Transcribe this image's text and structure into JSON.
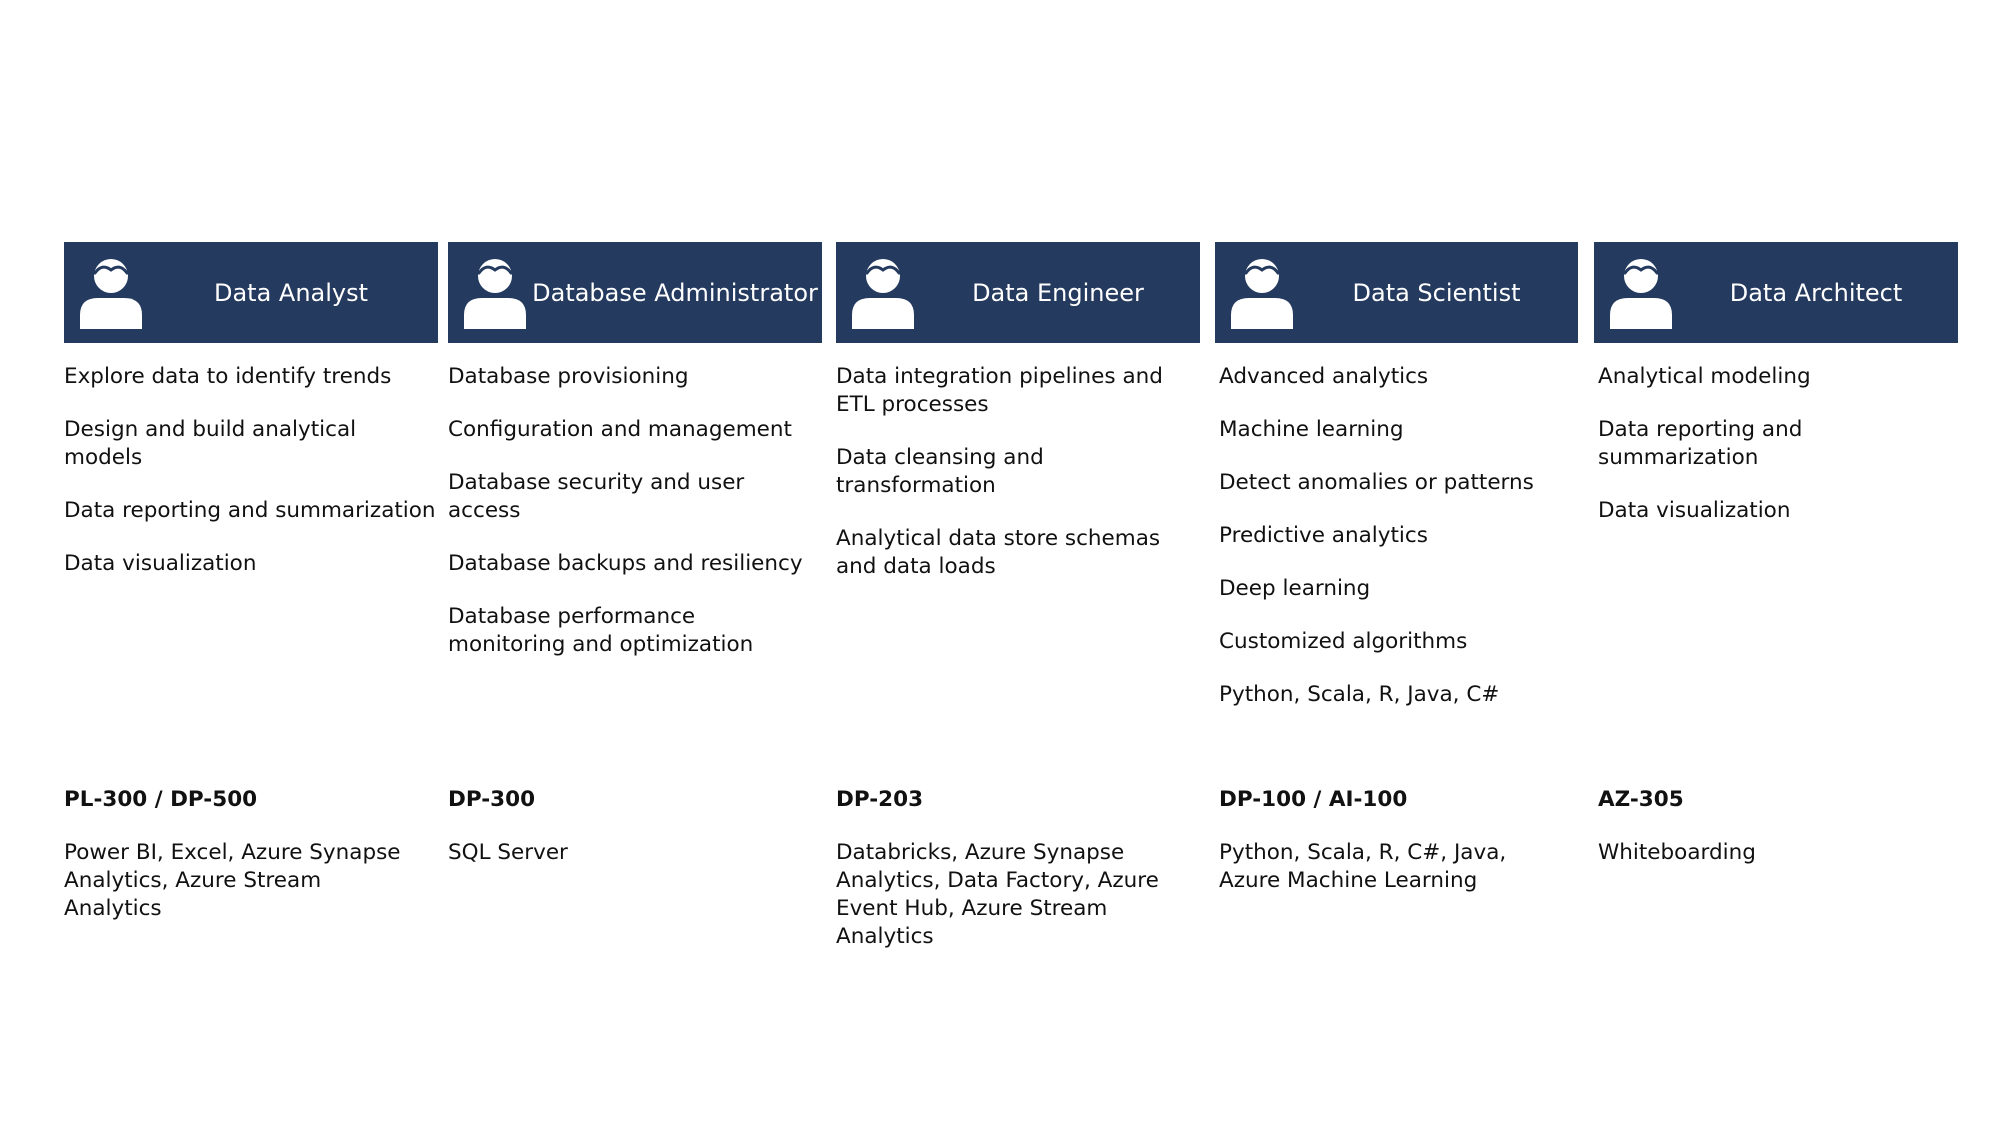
{
  "colors": {
    "header_bg": "#243a5e",
    "header_text": "#ffffff",
    "body_text": "#111111"
  },
  "roles": [
    {
      "title": "Data Analyst",
      "icon": "person-icon",
      "tasks": [
        "Explore data to identify trends",
        "Design and build analytical models",
        "Data reporting and summarization",
        "Data visualization"
      ],
      "certification": "PL-300 / DP-500",
      "tools": "Power BI, Excel, Azure Synapse Analytics, Azure Stream Analytics"
    },
    {
      "title": "Database Administrator",
      "icon": "person-icon",
      "tasks": [
        "Database provisioning",
        "Configuration and management",
        "Database security and user access",
        "Database backups and resiliency",
        "Database performance monitoring and optimization"
      ],
      "certification": "DP-300",
      "tools": "SQL Server"
    },
    {
      "title": "Data Engineer",
      "icon": "person-icon",
      "tasks": [
        "Data integration pipelines and ETL processes",
        "Data cleansing and transformation",
        "Analytical data store schemas and data loads"
      ],
      "certification": "DP-203",
      "tools": "Databricks, Azure Synapse Analytics, Data Factory, Azure Event Hub, Azure Stream Analytics"
    },
    {
      "title": "Data Scientist",
      "icon": "person-icon",
      "tasks": [
        "Advanced analytics",
        "Machine learning",
        "Detect anomalies or patterns",
        "Predictive analytics",
        "Deep learning",
        "Customized algorithms",
        "Python, Scala, R, Java, C#"
      ],
      "certification": "DP-100 / AI-100",
      "tools": "Python, Scala, R, C#, Java, Azure Machine Learning"
    },
    {
      "title": "Data Architect",
      "icon": "person-icon",
      "tasks": [
        "Analytical modeling",
        "Data reporting and summarization",
        "Data visualization"
      ],
      "certification": "AZ-305",
      "tools": "Whiteboarding"
    }
  ]
}
